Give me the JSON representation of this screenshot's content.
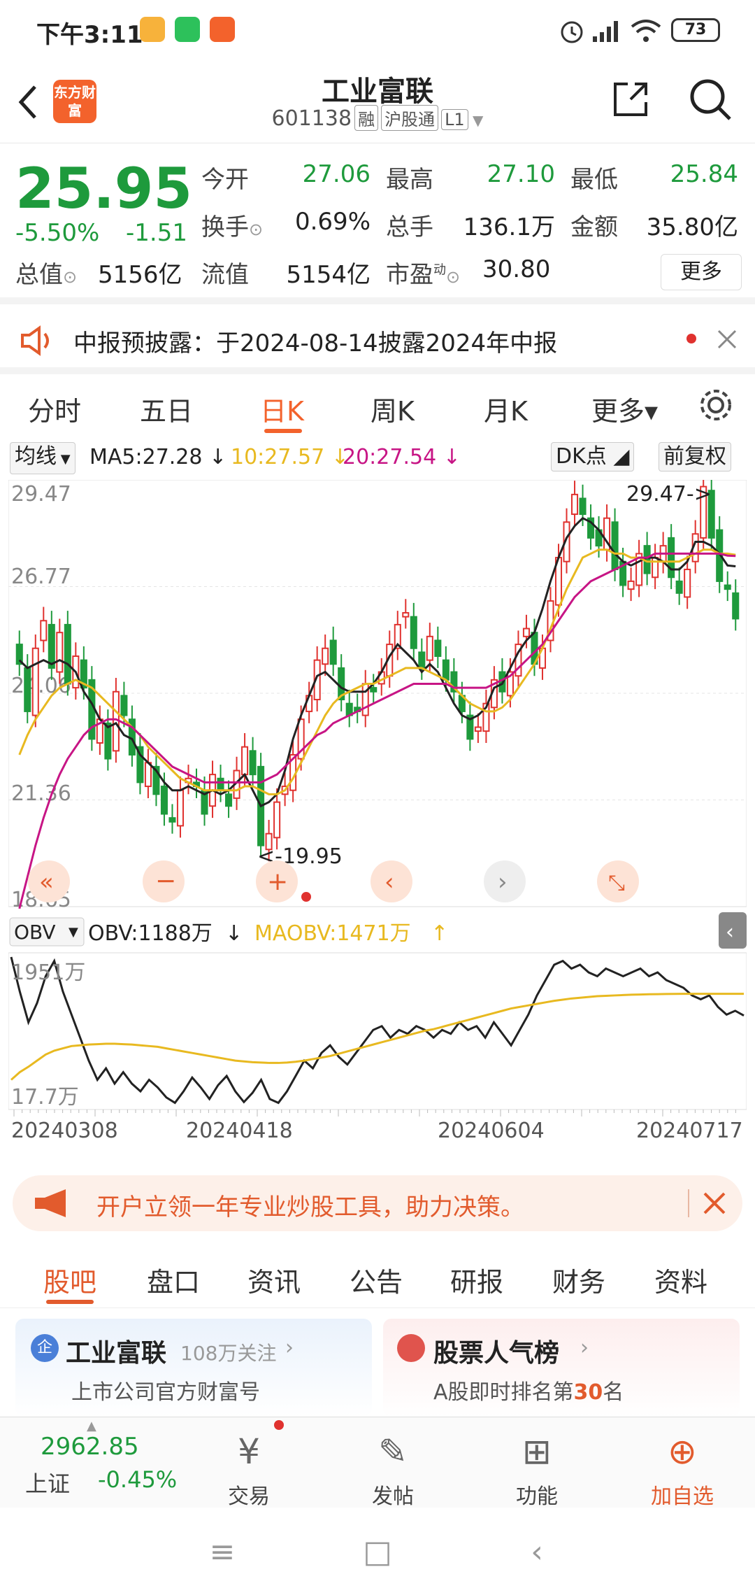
{
  "status_bar": {
    "time": "下午3:11",
    "battery": "73"
  },
  "header": {
    "logo_text": "东方财富",
    "stock_name": "工业富联",
    "stock_code": "601138",
    "tags": [
      "融",
      "沪股通",
      "L1"
    ]
  },
  "quote": {
    "price": "25.95",
    "change_pct": "-5.50%",
    "change": "-1.51",
    "open_label": "今开",
    "open": "27.06",
    "high_label": "最高",
    "high": "27.10",
    "low_label": "最低",
    "low": "25.84",
    "turnover_label": "换手",
    "turnover": "0.69%",
    "volume_label": "总手",
    "volume": "136.1万",
    "amount_label": "金额",
    "amount": "35.80亿",
    "mktcap_label": "总值",
    "mktcap": "5156亿",
    "float_label": "流值",
    "float": "5154亿",
    "pe_label": "市盈",
    "pe_sup": "动",
    "pe": "30.80",
    "more_label": "更多"
  },
  "notice": {
    "text": "中报预披露：于2024-08-14披露2024年中报"
  },
  "period_tabs": [
    "分时",
    "五日",
    "日K",
    "周K",
    "月K",
    "更多▾"
  ],
  "period_active": 2,
  "ma_legend": {
    "selector": "均线",
    "ma5": "MA5:27.28",
    "ma10": "10:27.57",
    "ma20": "20:27.54",
    "dk": "DK点",
    "adjust": "前复权"
  },
  "chart_data": {
    "type": "candlestick",
    "y_ticks": [
      "29.47",
      "26.77",
      "24.06",
      "21.36",
      "18.65"
    ],
    "ylim": [
      18.65,
      29.47
    ],
    "max_annotation": "29.47->",
    "min_annotation": "<-19.95",
    "dates": [
      "20240308",
      "20240418",
      "20240604",
      "20240717"
    ],
    "closes": [
      24.8,
      23.6,
      25.2,
      25.9,
      24.7,
      25.6,
      24.3,
      25.0,
      24.2,
      22.9,
      23.4,
      22.4,
      24.1,
      23.5,
      22.5,
      21.8,
      22.3,
      21.5,
      21.0,
      20.8,
      21.6,
      21.9,
      21.7,
      21.0,
      22.0,
      21.6,
      21.2,
      22.1,
      22.7,
      22.0,
      20.2,
      20.5,
      21.3,
      21.7,
      22.5,
      23.4,
      24.0,
      24.9,
      25.2,
      24.8,
      23.9,
      23.5,
      23.6,
      24.3,
      24.1,
      24.6,
      25.3,
      25.8,
      26.1,
      25.2,
      24.7,
      25.5,
      25.0,
      24.4,
      24.1,
      23.6,
      22.9,
      23.2,
      23.8,
      24.4,
      24.1,
      24.6,
      25.3,
      25.7,
      24.8,
      25.2,
      26.4,
      27.5,
      28.4,
      29.1,
      28.6,
      28.0,
      27.8,
      28.5,
      27.2,
      26.8,
      26.9,
      27.6,
      27.1,
      27.5,
      27.8,
      27.0,
      26.6,
      27.2,
      28.1,
      29.3,
      28.0,
      26.9,
      26.7,
      25.95
    ],
    "ma5": [
      24.9,
      24.7,
      24.8,
      24.9,
      24.8,
      24.9,
      24.8,
      24.6,
      24.1,
      23.8,
      23.4,
      23.2,
      23.3,
      23.0,
      22.9,
      22.5,
      22.3,
      22.1,
      21.8,
      21.6,
      21.6,
      21.7,
      21.6,
      21.5,
      21.6,
      21.5,
      21.6,
      21.8,
      22.0,
      21.6,
      21.2,
      21.3,
      21.5,
      22.1,
      22.9,
      23.5,
      24.0,
      24.5,
      24.6,
      24.4,
      24.2,
      24.1,
      24.1,
      24.1,
      24.3,
      24.6,
      25.0,
      25.3,
      25.1,
      24.9,
      24.6,
      24.8,
      24.6,
      24.2,
      23.8,
      23.5,
      23.4,
      23.5,
      23.7,
      24.2,
      24.3,
      24.7,
      25.1,
      25.4,
      25.6,
      26.2,
      26.9,
      27.5,
      28.0,
      28.3,
      28.5,
      28.4,
      28.2,
      27.9,
      27.6,
      27.4,
      27.3,
      27.4,
      27.5,
      27.5,
      27.4,
      27.2,
      27.2,
      27.4,
      27.9,
      27.9,
      27.8,
      27.6,
      27.3,
      27.28
    ],
    "ma10": [
      22.5,
      23.0,
      23.4,
      23.7,
      24.0,
      24.2,
      24.3,
      24.4,
      24.3,
      24.2,
      24.0,
      23.8,
      23.6,
      23.4,
      23.2,
      23.0,
      22.7,
      22.5,
      22.3,
      22.1,
      21.9,
      21.8,
      21.7,
      21.6,
      21.6,
      21.6,
      21.6,
      21.6,
      21.7,
      21.7,
      21.6,
      21.5,
      21.5,
      21.6,
      21.9,
      22.3,
      22.7,
      23.1,
      23.5,
      23.8,
      24.0,
      24.1,
      24.2,
      24.3,
      24.3,
      24.4,
      24.5,
      24.6,
      24.7,
      24.7,
      24.7,
      24.6,
      24.5,
      24.4,
      24.2,
      24.0,
      23.8,
      23.7,
      23.6,
      23.6,
      23.7,
      23.9,
      24.2,
      24.5,
      24.8,
      25.2,
      25.7,
      26.2,
      26.7,
      27.1,
      27.5,
      27.6,
      27.7,
      27.7,
      27.6,
      27.6,
      27.5,
      27.5,
      27.4,
      27.4,
      27.4,
      27.4,
      27.4,
      27.5,
      27.6,
      27.7,
      27.7,
      27.6,
      27.6,
      27.57
    ],
    "ma20": [
      18.6,
      19.4,
      20.2,
      20.9,
      21.5,
      22.0,
      22.4,
      22.7,
      23.0,
      23.2,
      23.3,
      23.4,
      23.4,
      23.3,
      23.2,
      23.0,
      22.8,
      22.6,
      22.4,
      22.2,
      22.1,
      22.0,
      21.9,
      21.8,
      21.8,
      21.8,
      21.8,
      21.8,
      21.8,
      21.8,
      21.8,
      21.9,
      22.0,
      22.2,
      22.4,
      22.6,
      22.8,
      23.0,
      23.1,
      23.3,
      23.4,
      23.5,
      23.6,
      23.7,
      23.8,
      23.9,
      24.0,
      24.1,
      24.2,
      24.3,
      24.3,
      24.3,
      24.3,
      24.3,
      24.2,
      24.2,
      24.2,
      24.2,
      24.2,
      24.3,
      24.4,
      24.5,
      24.7,
      24.9,
      25.1,
      25.3,
      25.6,
      25.9,
      26.2,
      26.5,
      26.7,
      26.9,
      27.0,
      27.1,
      27.2,
      27.3,
      27.4,
      27.5,
      27.5,
      27.6,
      27.6,
      27.6,
      27.6,
      27.6,
      27.6,
      27.6,
      27.6,
      27.6,
      27.55,
      27.54
    ],
    "colors": {
      "up": "#e0322f",
      "down": "#1e9a3c",
      "ma5": "#222222",
      "ma10": "#e8b920",
      "ma20": "#c71585"
    }
  },
  "obv": {
    "selector": "OBV",
    "obv_label": "OBV:1188万",
    "maobv_label": "MAOBV:1471万",
    "top_tick": "1951万",
    "bottom_tick": "17.7万",
    "obv_values": [
      1951,
      1500,
      1100,
      1350,
      1700,
      1900,
      1500,
      1200,
      900,
      600,
      350,
      500,
      300,
      450,
      300,
      200,
      350,
      250,
      120,
      50,
      200,
      380,
      250,
      100,
      280,
      400,
      200,
      60,
      180,
      350,
      100,
      50,
      200,
      400,
      600,
      500,
      700,
      800,
      650,
      550,
      700,
      850,
      1000,
      1050,
      900,
      1000,
      950,
      1050,
      1000,
      900,
      1000,
      950,
      1100,
      1000,
      1050,
      900,
      1100,
      950,
      800,
      1000,
      1200,
      1450,
      1650,
      1850,
      1900,
      1800,
      1850,
      1750,
      1700,
      1800,
      1750,
      1700,
      1750,
      1800,
      1700,
      1750,
      1650,
      1600,
      1550,
      1450,
      1400,
      1450,
      1300,
      1200,
      1250,
      1188
    ],
    "maobv_values": [
      350,
      450,
      520,
      600,
      680,
      730,
      760,
      790,
      800,
      810,
      815,
      820,
      820,
      815,
      810,
      800,
      790,
      780,
      760,
      740,
      720,
      700,
      680,
      660,
      640,
      620,
      600,
      590,
      580,
      575,
      570,
      570,
      575,
      585,
      600,
      620,
      640,
      660,
      690,
      720,
      750,
      780,
      810,
      840,
      870,
      900,
      930,
      960,
      990,
      1010,
      1040,
      1070,
      1100,
      1130,
      1160,
      1190,
      1220,
      1250,
      1280,
      1300,
      1320,
      1340,
      1360,
      1380,
      1395,
      1410,
      1420,
      1430,
      1440,
      1445,
      1450,
      1455,
      1460,
      1462,
      1465,
      1467,
      1469,
      1470,
      1471,
      1471,
      1471,
      1471,
      1471,
      1471,
      1471,
      1471
    ]
  },
  "promo": {
    "text": "开户立领一年专业炒股工具，助力决策。"
  },
  "bottom_tabs": [
    "股吧",
    "盘口",
    "资讯",
    "公告",
    "研报",
    "财务",
    "资料"
  ],
  "bottom_active": 0,
  "cards": {
    "left_title": "工业富联",
    "left_follow": "108万关注",
    "left_sub": "上市公司官方财富号",
    "right_title": "股票人气榜",
    "right_sub_prefix": "A股即时排名第",
    "right_rank": "30",
    "right_sub_suffix": "名"
  },
  "bottom_nav": {
    "index_value": "2962.85",
    "index_name": "上证",
    "index_change": "-0.45%",
    "trade": "交易",
    "post": "发帖",
    "func": "功能",
    "add": "加自选"
  }
}
